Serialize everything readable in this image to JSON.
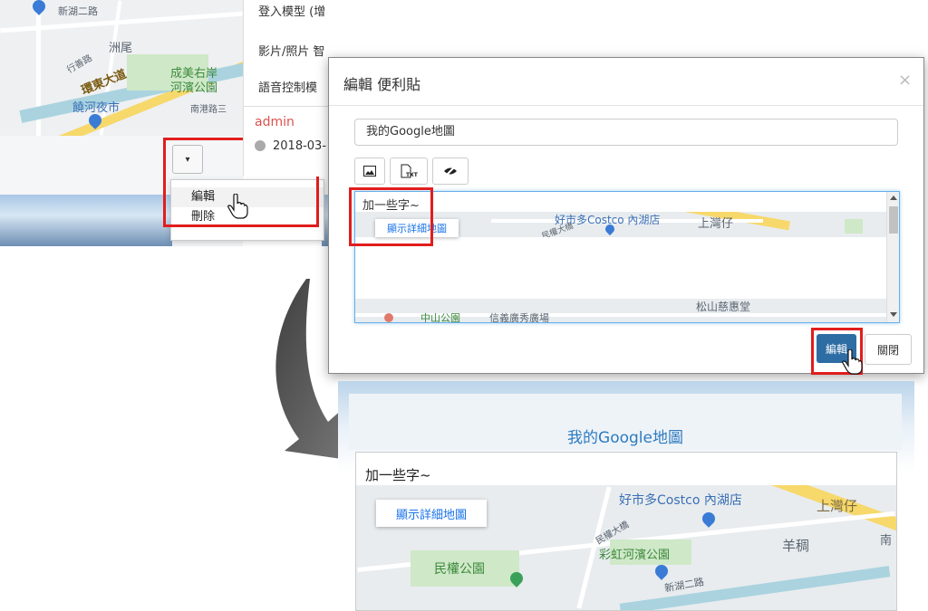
{
  "left_panel": {
    "map_labels": [
      "新湖二路",
      "洲尾",
      "行善路",
      "環東大道",
      "成美右岸",
      "河濱公園",
      "饒河夜市",
      "南港路三"
    ],
    "dropdown_caret": "▾",
    "menu_items": [
      "編輯",
      "刪除"
    ]
  },
  "center_panel": {
    "rows": [
      "登入模型 (增",
      "影片/照片 智",
      "語音控制模"
    ],
    "author": "admin",
    "date": "2018-03-"
  },
  "modal": {
    "title": "編輯 便利貼",
    "close": "×",
    "title_input_value": "我的Google地圖",
    "tool_icons": [
      "image-icon",
      "txt-file-icon",
      "eye-slash-icon"
    ],
    "editor_text": "加一些字~",
    "map_button": "顯示詳細地圖",
    "map_labels": [
      "好市多Costco 內湖店",
      "上灣仔",
      "民權大橋",
      "松山慈惠堂",
      "中山公園",
      "信義廣秀廣場"
    ],
    "edit_button": "編輯",
    "close_button": "關閉"
  },
  "result": {
    "title": "我的Google地圖",
    "text": "加一些字~",
    "map_button": "顯示詳細地圖",
    "map_labels": [
      "好市多Costco 內湖店",
      "上灣仔",
      "民權大橋",
      "彩虹河濱公園",
      "羊稠",
      "民權公園",
      "新湖二路",
      "南"
    ]
  },
  "colors": {
    "highlight": "#e21d1d",
    "primary": "#2e6da4",
    "arrow": "#5a5a5a"
  }
}
